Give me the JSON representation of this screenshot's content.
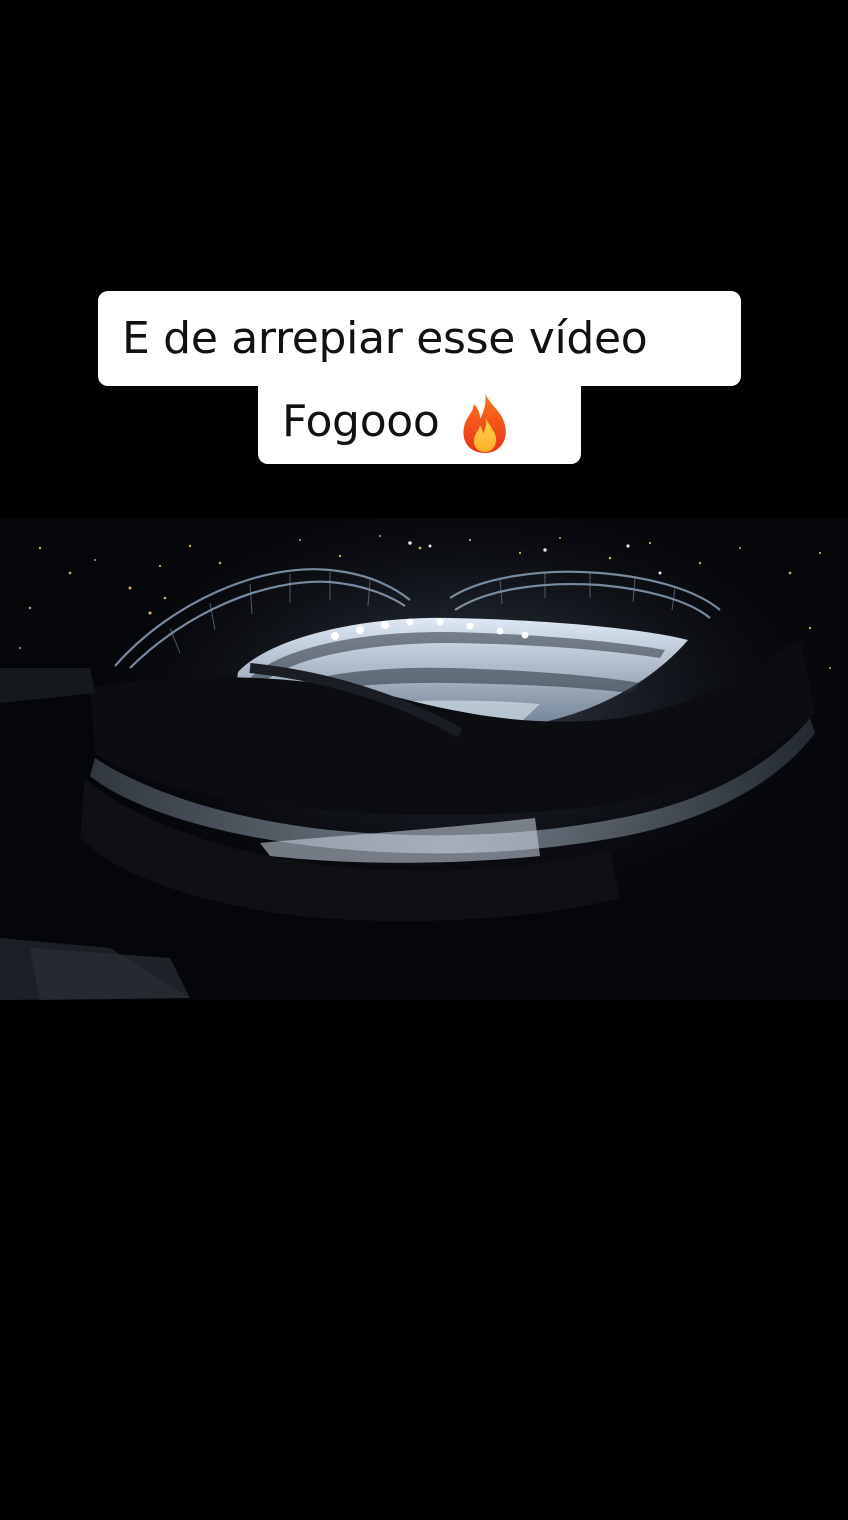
{
  "caption": {
    "line1": "E de arrepiar esse vídeo",
    "line2": "Fogooo",
    "emoji": "fire-icon"
  },
  "media": {
    "scene": "stadium-night-aerial"
  },
  "colors": {
    "background": "#000000",
    "caption_bg": "#ffffff",
    "caption_text": "#111111",
    "stadium_light": "#e8f2ff"
  }
}
